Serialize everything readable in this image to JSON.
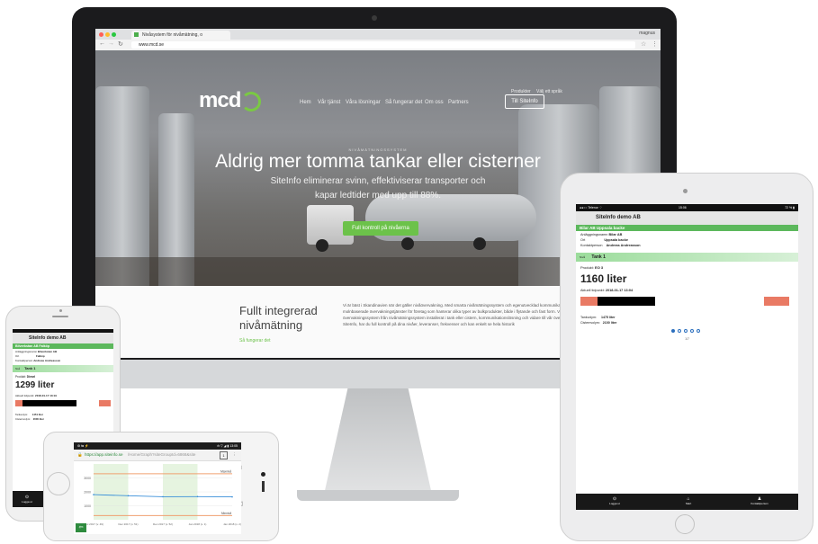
{
  "desktop": {
    "browser": {
      "tab_title": "Nivåsystem för nivåmätning, o",
      "url": "www.mcd.se",
      "profile": "magnus"
    },
    "site": {
      "logo": "mcd",
      "nav": [
        "Hem",
        "Vår tjänst",
        "Våra lösningar",
        "Så fungerar det",
        "Om oss",
        "Partners"
      ],
      "nav_cta": "Till SiteInfo",
      "lang_links": [
        "Produkter",
        "Välj ett språk"
      ],
      "eyebrow": "NIVÅMÄTNINGSSYSTEM",
      "hero_title": "Aldrig mer tomma tankar eller cisterner",
      "hero_sub_line1": "SiteInfo eliminerar svinn, effektiviserar transporter och",
      "hero_sub_line2": "kapar ledtider med upp till 88%.",
      "hero_button": "Full kontroll på nivåerna",
      "section_title_1": "Fullt integrerad",
      "section_title_2": "nivåmätning",
      "section_link": "Så fungerar det",
      "section_body": "Vi är bäst i Skandinavien när det gäller nivåövervakning. Med smarta nivåmätningssystem och egenutvecklad kommunikationslösning erbjuder vi molnbaserade övervakningstjänster för företag som hanterar olika typer av bulkprodukter, både i flytande och fast form. Vi tillhandahåller fullt integrerat övervakningssystem från nivåmätningssystem installerat i tank eller cistern, kommunikationslösning och vidare till vår övervakningstjänst SiteInfo. Genom SiteInfo, har du full kontroll på dina nivåer, leveranser, frekvenser och kan enkelt se hela historik"
    }
  },
  "tablet": {
    "status_left": "●●○○ Telenor ⌔",
    "status_center": "15:06",
    "status_right": "72 % ▮",
    "app_title": "SiteInfo demo AB",
    "site_header": "Bilar AB Uppsala backe",
    "info_labels": [
      "Anläggningsnamn",
      "Ort",
      "Kontaktperson"
    ],
    "info_values": [
      "Bilar AB",
      "Uppsala backe",
      "Andreas Andreasson"
    ],
    "tank_prefix": "Nivå",
    "tank_label": "Tank 1",
    "product_label": "Produkt:",
    "product_value": "EO 3",
    "volume": "1160 liter",
    "updated_label": "Aktuell tidpunkt:",
    "updated_value": "2018-01-17 13:04",
    "level_fraction": 0.31,
    "tank_volume_label": "Tankvolym:",
    "tank_volume_value": "1475 liter",
    "cistern_volume_label": "Cisternvolym:",
    "cistern_volume_value": "2100 liter",
    "page_current": 1,
    "page_total": 5,
    "page_text": "1/7",
    "nav": [
      {
        "label": "Logga ut",
        "icon": "⊙"
      },
      {
        "label": "Start",
        "icon": "⌂"
      },
      {
        "label": "Kontaktperson",
        "icon": "♟"
      }
    ],
    "accent_color": "#5cb85c",
    "level_color": "#e97a64"
  },
  "phone": {
    "app_title": "SiteInfo demo AB",
    "site_header": "Bilverkstan AB Falköp",
    "info_labels": [
      "Anläggningsnamn",
      "Ort",
      "Kontaktperson"
    ],
    "info_values": [
      "Bilverkstan AB",
      "Falköp",
      "Andreas Andreasson"
    ],
    "tank_prefix": "Nivå",
    "tank_label": "Tank 1",
    "product_label": "Produkt:",
    "product_value": "Diesel",
    "volume": "1299 liter",
    "updated_label": "Aktuell tidpunkt:",
    "updated_value": "2018-01-17 13:19",
    "level_fraction": 0.62,
    "tank_volume_label": "Tankvolym:",
    "tank_volume_value": "1451 liter",
    "cistern_volume_label": "Cisternvolym:",
    "cistern_volume_value": "2000 liter",
    "nav_label": "Logga ut",
    "nav_icon": "⊙"
  },
  "android": {
    "status_left": "⚙ ⇆ ⚡",
    "status_right": "⊖ ▽ ◢ ▮ 13:05",
    "url_host": "https://app.siteinfo.se",
    "url_path": "/Home/Graph?siteGroupId=6868&site",
    "url_tabs": "1",
    "menu_icon": "⋮",
    "back_btn": "⇦",
    "nav_icons": [
      "□",
      "○",
      "◁"
    ]
  },
  "chart_data": {
    "type": "line",
    "title": "",
    "xlabel": "",
    "ylabel": "",
    "x": [
      "Dec 2017 (v. 49)",
      "Dec 2017 (v. 51)",
      "Dec 2017 (v. 52)",
      "Jan 2018 (v. 1)",
      "Jan 2018 (v. 2)"
    ],
    "ylim": [
      0,
      4000
    ],
    "yticks": [
      "3000",
      "2000",
      "1000"
    ],
    "series": [
      {
        "name": "",
        "values": [
          1800,
          1720,
          1650,
          1660,
          1640
        ]
      }
    ],
    "reference_lines": [
      {
        "name": "Maxnivå",
        "value": 3300
      },
      {
        "name": "Minnivå",
        "value": 300
      }
    ],
    "series_color": "#3a8fd9",
    "ref_color": "#f0a070",
    "band_color": "#e6f4e0"
  }
}
